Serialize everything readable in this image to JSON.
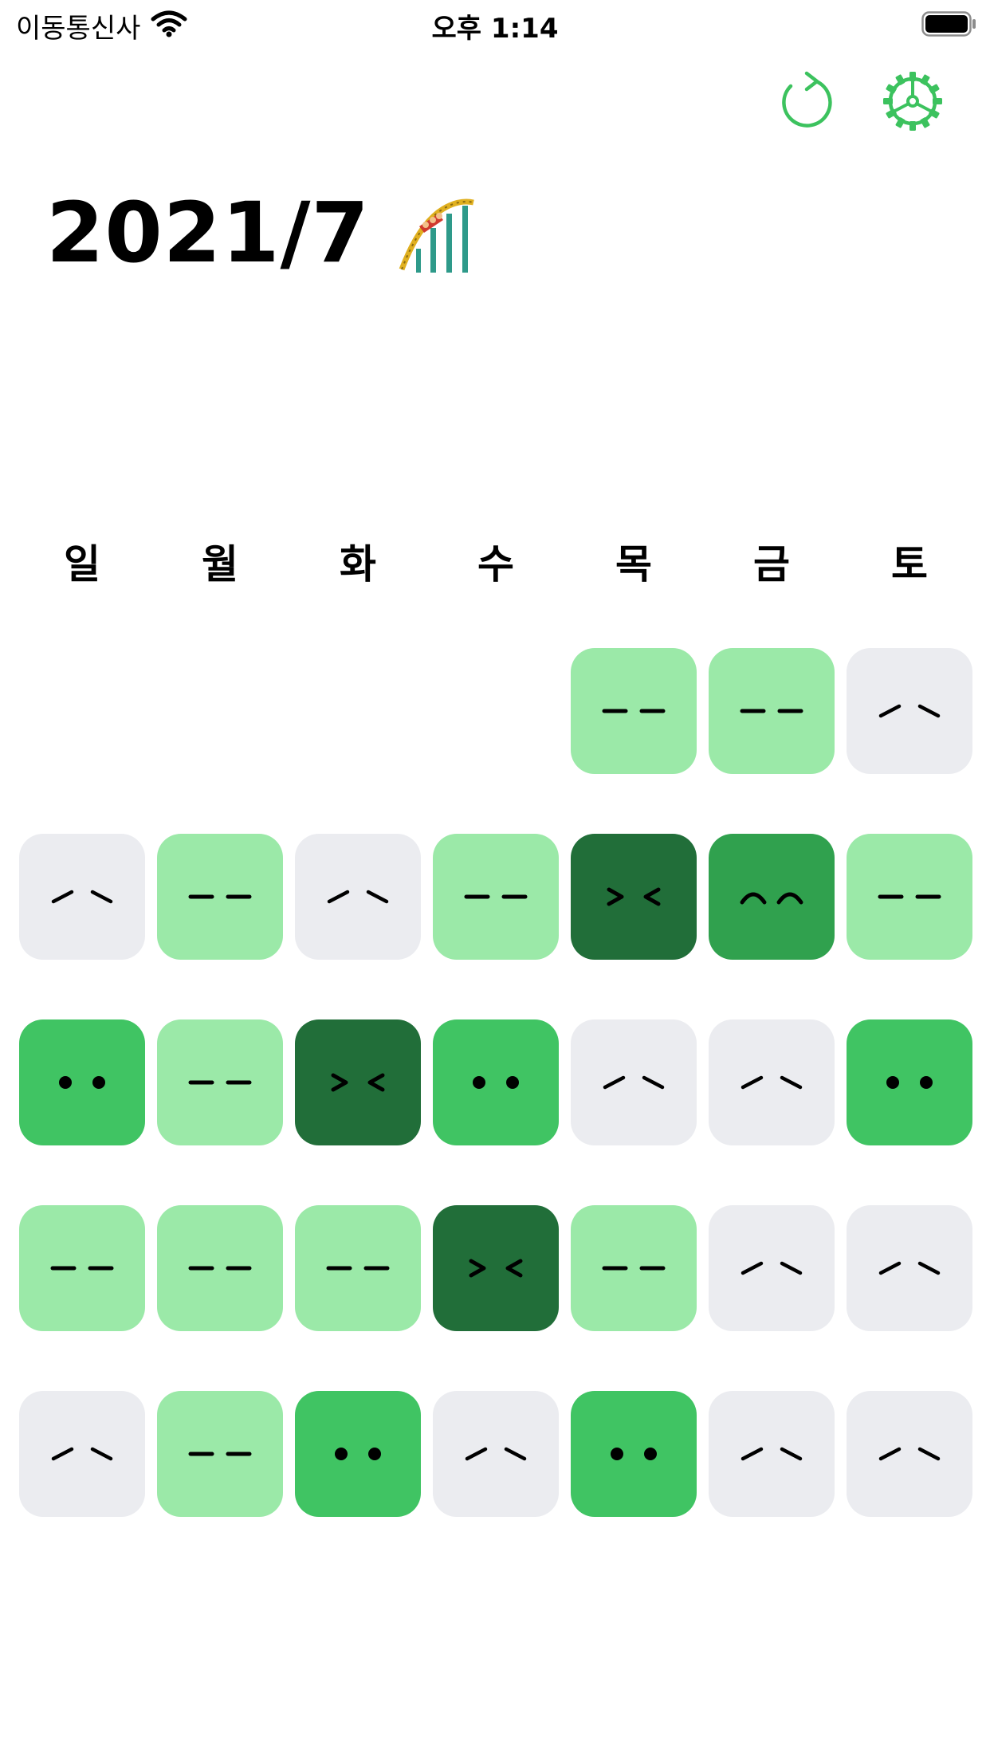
{
  "status_bar": {
    "carrier": "이동통신사",
    "time": "오후 1:14"
  },
  "toolbar": {
    "refresh_icon": "refresh-icon",
    "settings_icon": "gear-icon"
  },
  "header": {
    "title": "2021/7",
    "emoji_icon": "roller-coaster-icon"
  },
  "colors": {
    "accent": "#3CC25E",
    "level_none": "#EBECF0",
    "level_1": "#9BE9A8",
    "level_2": "#40C463",
    "level_3": "#30A14E",
    "level_4": "#216E39"
  },
  "weekdays": [
    "일",
    "월",
    "화",
    "수",
    "목",
    "금",
    "토"
  ],
  "calendar": {
    "weeks": [
      [
        null,
        null,
        null,
        null,
        {
          "level": 1,
          "face": "dash"
        },
        {
          "level": 1,
          "face": "dash"
        },
        {
          "level": 0,
          "face": "slant"
        }
      ],
      [
        {
          "level": 0,
          "face": "slant"
        },
        {
          "level": 1,
          "face": "dash"
        },
        {
          "level": 0,
          "face": "slant"
        },
        {
          "level": 1,
          "face": "dash"
        },
        {
          "level": 4,
          "face": "squint"
        },
        {
          "level": 3,
          "face": "arc"
        },
        {
          "level": 1,
          "face": "dash"
        }
      ],
      [
        {
          "level": 2,
          "face": "dot"
        },
        {
          "level": 1,
          "face": "dash"
        },
        {
          "level": 4,
          "face": "squint"
        },
        {
          "level": 2,
          "face": "dot"
        },
        {
          "level": 0,
          "face": "slant"
        },
        {
          "level": 0,
          "face": "slant"
        },
        {
          "level": 2,
          "face": "dot"
        }
      ],
      [
        {
          "level": 1,
          "face": "dash"
        },
        {
          "level": 1,
          "face": "dash"
        },
        {
          "level": 1,
          "face": "dash"
        },
        {
          "level": 4,
          "face": "squint"
        },
        {
          "level": 1,
          "face": "dash"
        },
        {
          "level": 0,
          "face": "slant"
        },
        {
          "level": 0,
          "face": "slant"
        }
      ],
      [
        {
          "level": 0,
          "face": "slant"
        },
        {
          "level": 1,
          "face": "dash"
        },
        {
          "level": 2,
          "face": "dot"
        },
        {
          "level": 0,
          "face": "slant"
        },
        {
          "level": 2,
          "face": "dot"
        },
        {
          "level": 0,
          "face": "slant"
        },
        {
          "level": 0,
          "face": "slant"
        }
      ]
    ]
  }
}
